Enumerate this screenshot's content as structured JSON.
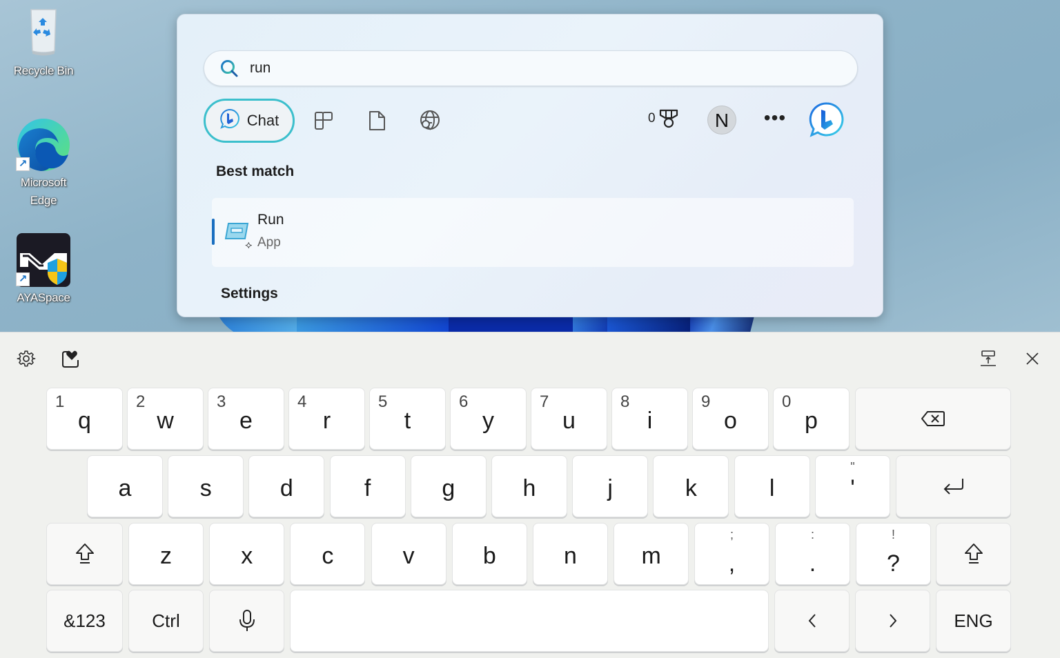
{
  "desktop": {
    "icons": [
      {
        "label": "Recycle Bin",
        "icon": "recycle-bin-icon"
      },
      {
        "label": "Microsoft\nEdge",
        "label_line1": "Microsoft",
        "label_line2": "Edge",
        "icon": "edge-icon",
        "shortcut": true
      },
      {
        "label": "AYASpace",
        "icon": "ayaspace-icon",
        "shortcut": true
      }
    ]
  },
  "search": {
    "query": "run",
    "placeholder": "",
    "icon": "search-icon",
    "filters": {
      "chat_label": "Chat",
      "apps_icon": "apps-grid-icon",
      "documents_icon": "document-icon",
      "web_icon": "web-search-globe-icon"
    },
    "rewards_count": "0",
    "rewards_icon": "medal-icon",
    "avatar_initial": "N",
    "more_label": "•••",
    "bing_icon": "bing-chat-icon",
    "best_match_title": "Best match",
    "best_match": {
      "name": "Run",
      "type": "App",
      "icon": "run-app-icon"
    },
    "settings_title": "Settings"
  },
  "keyboard": {
    "toolbar": {
      "settings_icon": "gear-icon",
      "stickers_icon": "clipboard-heart-icon",
      "dock_icon": "undock-keyboard-icon",
      "close_icon": "close-icon"
    },
    "row1": [
      {
        "key": "q",
        "sub": "1"
      },
      {
        "key": "w",
        "sub": "2"
      },
      {
        "key": "e",
        "sub": "3"
      },
      {
        "key": "r",
        "sub": "4"
      },
      {
        "key": "t",
        "sub": "5"
      },
      {
        "key": "y",
        "sub": "6"
      },
      {
        "key": "u",
        "sub": "7"
      },
      {
        "key": "i",
        "sub": "8"
      },
      {
        "key": "o",
        "sub": "9"
      },
      {
        "key": "p",
        "sub": "0"
      }
    ],
    "backspace_icon": "backspace-icon",
    "row2": [
      "a",
      "s",
      "d",
      "f",
      "g",
      "h",
      "j",
      "k",
      "l"
    ],
    "apostrophe": {
      "main": "'",
      "alt": "\""
    },
    "enter_icon": "enter-icon",
    "row3": [
      "z",
      "x",
      "c",
      "v",
      "b",
      "n",
      "m"
    ],
    "punct": [
      {
        "main": ",",
        "alt": ";"
      },
      {
        "main": ".",
        "alt": ":"
      },
      {
        "main": "?",
        "alt": "!"
      }
    ],
    "shift_icon": "shift-icon",
    "row4": {
      "symbols_label": "&123",
      "ctrl_label": "Ctrl",
      "mic_icon": "microphone-icon",
      "left_label": "‹",
      "right_label": "›",
      "lang_label": "ENG"
    }
  }
}
